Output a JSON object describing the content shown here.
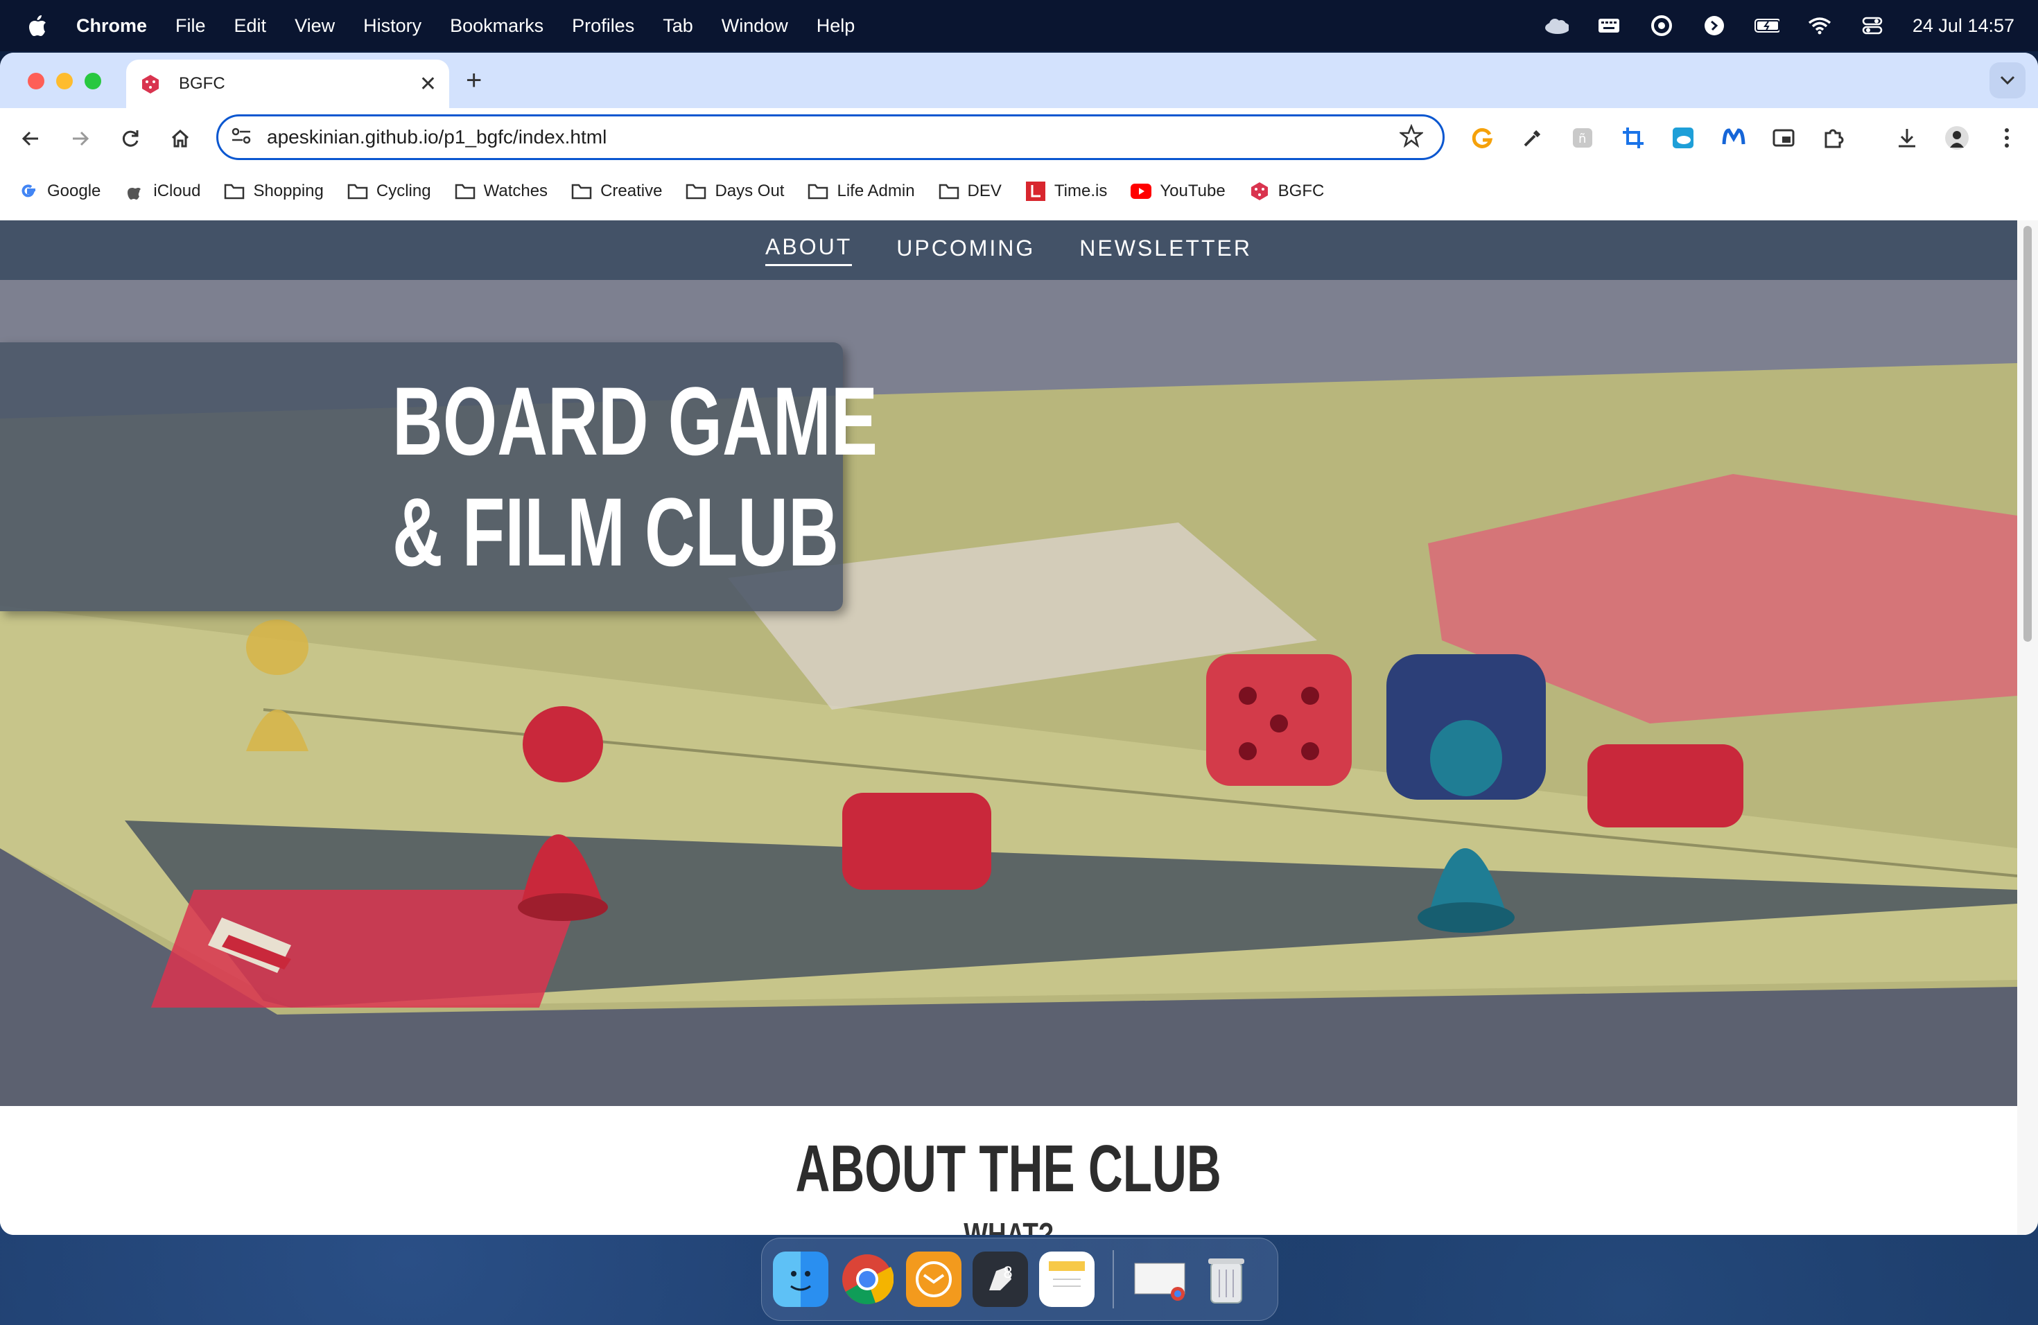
{
  "menubar": {
    "app": "Chrome",
    "items": [
      "File",
      "Edit",
      "View",
      "History",
      "Bookmarks",
      "Profiles",
      "Tab",
      "Window",
      "Help"
    ],
    "clock": "24 Jul  14:57"
  },
  "tab": {
    "title": "BGFC"
  },
  "omnibox": {
    "url": "apeskinian.github.io/p1_bgfc/index.html"
  },
  "bookmarks": [
    "Google",
    "iCloud",
    "Shopping",
    "Cycling",
    "Watches",
    "Creative",
    "Days Out",
    "Life Admin",
    "DEV",
    "Time.is",
    "YouTube",
    "BGFC"
  ],
  "site": {
    "nav": [
      "ABOUT",
      "UPCOMING",
      "NEWSLETTER"
    ],
    "hero_title_line1": "BOARD GAME",
    "hero_title_line2": "& FILM CLUB",
    "about_heading": "ABOUT THE CLUB",
    "about_sub": "WHAT?"
  },
  "colors": {
    "accent": "#0b57d0",
    "nav_bg": "#435267",
    "tabstrip": "#d3e2fd"
  }
}
